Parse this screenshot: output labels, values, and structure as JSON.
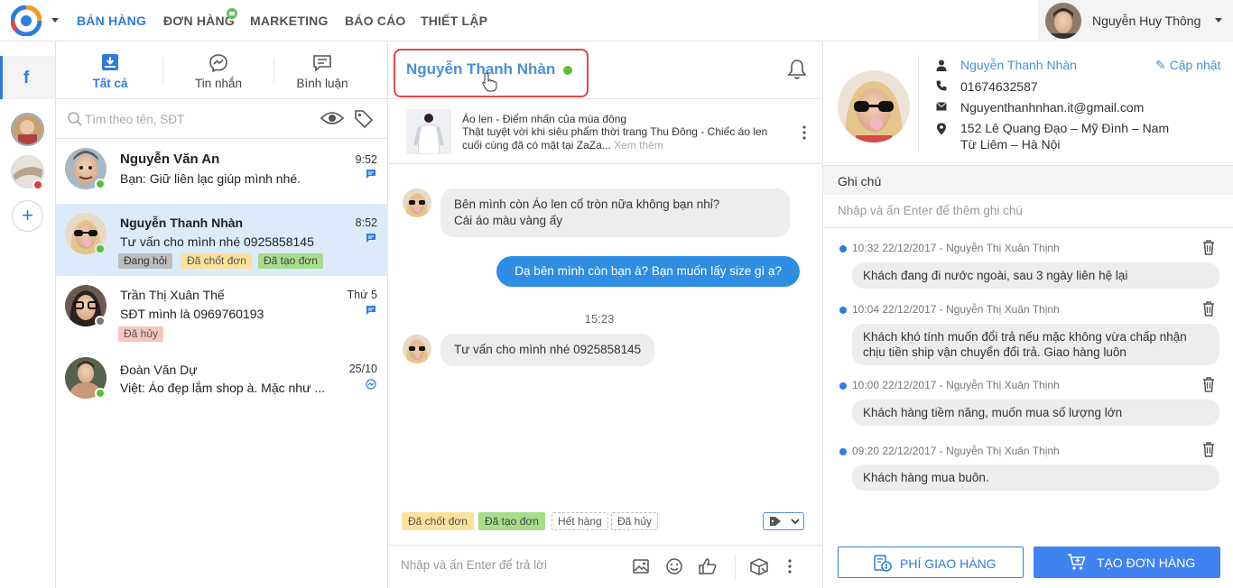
{
  "topbar": {
    "nav": [
      {
        "label": "BÁN HÀNG",
        "active": true
      },
      {
        "label": "ĐƠN HÀNG"
      },
      {
        "label": "MARKETING"
      },
      {
        "label": "BÁO CÁO"
      },
      {
        "label": "THIẾT LẬP"
      }
    ],
    "user_name": "Nguyễn Huy Thông"
  },
  "rail": {
    "facebook_label": "f",
    "add_label": "+"
  },
  "inbox": {
    "tabs": [
      {
        "label": "Tất cả",
        "icon": "inbox-icon"
      },
      {
        "label": "Tin nhắn",
        "icon": "messenger-icon"
      },
      {
        "label": "Bình luận",
        "icon": "comment-icon"
      }
    ],
    "search_placeholder": "Tìm theo tên, SĐT",
    "conversations": [
      {
        "name": "Nguyễn Văn An",
        "message": "Bạn: Giữ liên lạc giúp mình nhé.",
        "time": "9:52",
        "status": "online",
        "unread": true,
        "tags": []
      },
      {
        "name": "Nguyễn Thanh Nhàn",
        "message": "Tư vấn cho mình nhé 0925858145",
        "time": "8:52",
        "status": "online",
        "active": true,
        "tags": [
          "Đang hỏi",
          "Đã chốt đơn",
          "Đã tạo đơn"
        ]
      },
      {
        "name": "Trần Thị Xuân Thế",
        "message": "SĐT mình là 0969760193",
        "time": "Thứ 5",
        "status": "offline",
        "tags": [
          "Đã hủy"
        ]
      },
      {
        "name": "Đoàn Văn Dự",
        "message": "Việt: Áo đẹp lắm shop à. Mặc như ...",
        "time": "25/10",
        "status": "online",
        "tags": []
      }
    ]
  },
  "chat": {
    "title": "Nguyễn Thanh Nhàn",
    "product": {
      "title": "Áo len - Điểm nhấn của mùa đông",
      "description": "Thật tuyệt vời khi siêu phẩm thời trang Thu Đông - Chiếc áo len cuối cùng đã có mặt tại ZaZa...",
      "more": "Xem thêm"
    },
    "messages": [
      {
        "from": "customer",
        "text": "Bên mình còn Áo len cổ tròn nữa không bạn nhỉ?\nCái áo màu vàng ấy"
      },
      {
        "from": "shop",
        "text": "Dạ bên mình còn bạn à? Bạn muốn lấy size gì ạ?"
      },
      {
        "from": "customer",
        "text": "Tư vấn cho mình nhé 0925858145"
      }
    ],
    "divider_time": "15:23",
    "quick_tags": [
      "Đã chốt đơn",
      "Đã tạo đơn",
      "Hết hàng",
      "Đã hủy"
    ],
    "reply_placeholder": "Nhập và ấn Enter để trả lời"
  },
  "customer": {
    "name": "Nguyễn Thanh Nhàn",
    "edit_label": "Cập nhật",
    "phone": "01674632587",
    "email": "Nguyenthanhnhan.it@gmail.com",
    "address_line1": "152 Lê Quang Đạo – Mỹ Đình – Nam",
    "address_line2": "Từ Liêm – Hà Nội",
    "notes_title": "Ghi chú",
    "notes_placeholder": "Nhập và ấn Enter để thêm ghi chú",
    "notes": [
      {
        "meta": "10:32 22/12/2017 - Nguyễn Thị Xuân Thịnh",
        "text": "Khách đang đi nước ngoài, sau 3 ngày liên hệ lại"
      },
      {
        "meta": "10:04 22/12/2017 - Nguyễn Thị Xuân Thịnh",
        "text": "Khách khó tính muốn đổi trả nếu mặc không vừa chấp nhận chịu tiền ship vận chuyển đổi trả. Giao hàng luôn"
      },
      {
        "meta": "10:00 22/12/2017 - Nguyễn Thị Xuân Thịnh",
        "text": "Khách hàng tiềm năng, muốn mua số lượng lớn"
      },
      {
        "meta": "09:20 22/12/2017 - Nguyễn Thị Xuân Thịnh",
        "text": "Khách hàng mua buôn."
      }
    ],
    "ship_button": "PHÍ GIAO HÀNG",
    "order_button": "TẠO ĐƠN HÀNG"
  },
  "colors": {
    "accent": "#2e7ce0",
    "online": "#5cbf3b",
    "highlight": "#e04848"
  }
}
